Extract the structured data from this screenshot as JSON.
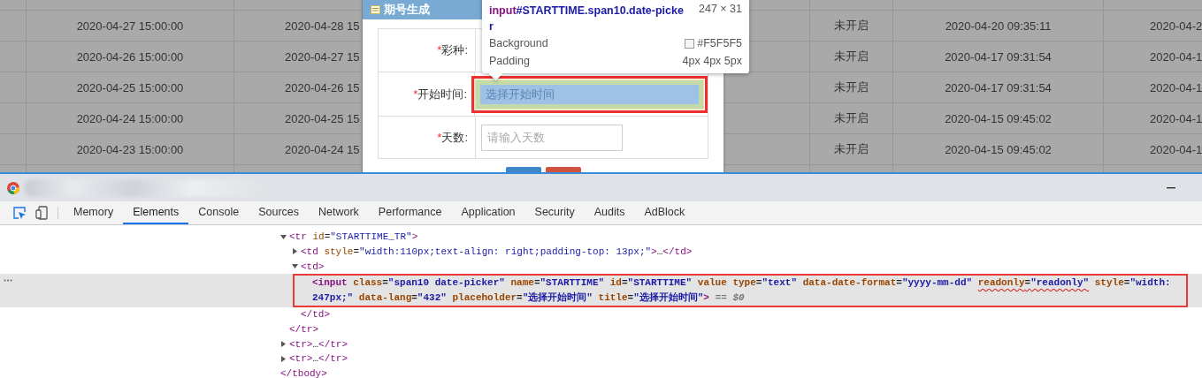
{
  "background_table": {
    "rows": [
      {
        "cells": [
          "2020-04-27 15:00:00",
          "2020-04-28 15",
          "未开启",
          "2020-04-20 09:35:11",
          "2020-04-2"
        ]
      },
      {
        "cells": [
          "2020-04-26 15:00:00",
          "2020-04-27 15",
          "未开启",
          "2020-04-17 09:31:54",
          "2020-04-1"
        ]
      },
      {
        "cells": [
          "2020-04-25 15:00:00",
          "2020-04-26 15",
          "未开启",
          "2020-04-17 09:31:54",
          "2020-04-1"
        ]
      },
      {
        "cells": [
          "2020-04-24 15:00:00",
          "2020-04-25 15",
          "未开启",
          "2020-04-15 09:45:02",
          "2020-04-1"
        ]
      },
      {
        "cells": [
          "2020-04-23 15:00:00",
          "2020-04-24 15",
          "未开启",
          "2020-04-15 09:45:02",
          "2020-04-1"
        ]
      }
    ]
  },
  "dialog": {
    "title": "期号生成",
    "fields": [
      {
        "marker": "*",
        "label": "彩种:",
        "kind": "covered"
      },
      {
        "marker": "*",
        "label": "开始时间:",
        "kind": "input",
        "placeholder": "选择开始时间",
        "highlighted": true,
        "annotated": true
      },
      {
        "marker": "*",
        "label": "天数:",
        "kind": "input",
        "placeholder": "请输入天数",
        "highlighted": false,
        "annotated": false
      }
    ],
    "buttons": [
      {
        "kind": "primary"
      },
      {
        "kind": "danger"
      }
    ]
  },
  "inspector_tooltip": {
    "tag": "input",
    "selector": "#STARTTIME.span10.date-picker",
    "size": "247 × 31",
    "properties": [
      {
        "name": "Background",
        "value": "#F5F5F5",
        "swatch": true
      },
      {
        "name": "Padding",
        "value": "4px 4px 5px"
      }
    ]
  },
  "devtools": {
    "tabs": [
      {
        "label": "Memory",
        "selected": false
      },
      {
        "label": "Elements",
        "selected": true
      },
      {
        "label": "Console",
        "selected": false
      },
      {
        "label": "Sources",
        "selected": false
      },
      {
        "label": "Network",
        "selected": false
      },
      {
        "label": "Performance",
        "selected": false
      },
      {
        "label": "Application",
        "selected": false
      },
      {
        "label": "Security",
        "selected": false
      },
      {
        "label": "Audits",
        "selected": false
      },
      {
        "label": "AdBlock",
        "selected": false
      }
    ],
    "nodes": [
      {
        "text": "<tr id=\"STARTTIME_TR\">",
        "expanded": true,
        "selected": false,
        "annotated": false,
        "close": "</tr>",
        "children": [
          {
            "text": "<td style=\"width:110px;text-align: right;padding-top: 13px;\">…</td>",
            "expanded": false,
            "selected": false,
            "annotated": false
          },
          {
            "text": "<td>",
            "expanded": true,
            "selected": false,
            "annotated": false,
            "close": "</td>",
            "children": [
              {
                "parts": [
                  {
                    "text": "<input class=\"span10 date-picker\" name=\"STARTTIME\" id=\"STARTTIME\" value type=\"text\" data-date-format=\"yyyy-mm-dd\" ",
                    "underlined": false
                  },
                  {
                    "text": "readonly=\"readonly\"",
                    "underlined": true
                  },
                  {
                    "text": " style=\"width: 247px;\" data-lang=\"432\" placeholder=\"选择开始时间\" title=\"选择开始时间\">",
                    "underlined": false
                  }
                ],
                "suffix": "== $0",
                "selected": true,
                "annotated": true
              }
            ]
          }
        ]
      },
      {
        "text": "<tr>…</tr>",
        "expanded": false,
        "selected": false,
        "annotated": false
      },
      {
        "text": "<tr>…</tr>",
        "expanded": false,
        "selected": false,
        "annotated": false
      }
    ],
    "close": "</tbody>"
  }
}
